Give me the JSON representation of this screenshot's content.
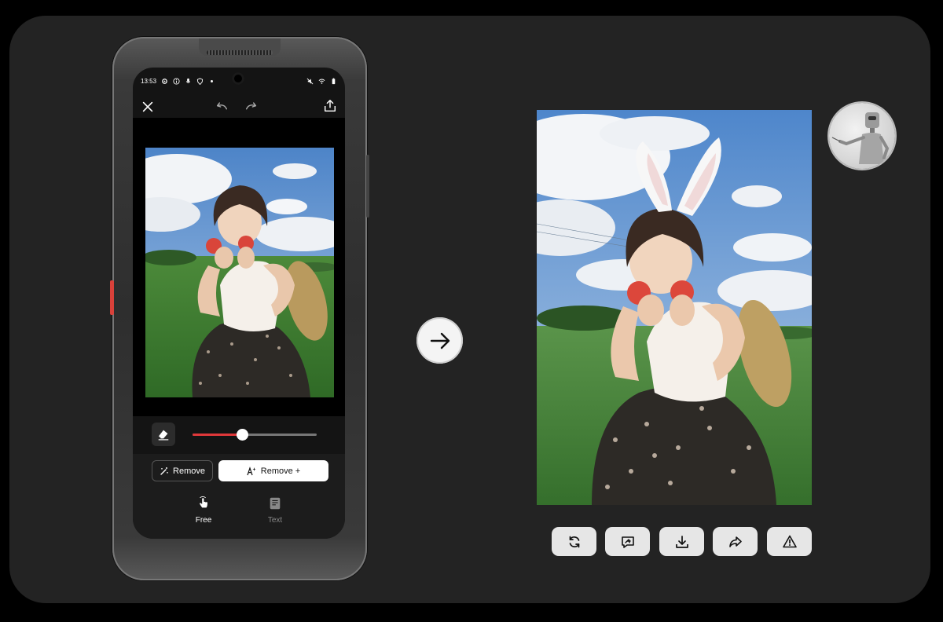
{
  "phone": {
    "status": {
      "time": "13:53",
      "left_icons": [
        "settings-icon",
        "info-icon",
        "mic-icon",
        "shield-icon",
        "dot-icon"
      ],
      "right_icons": [
        "mute-icon",
        "wifi-icon",
        "battery-icon"
      ]
    },
    "toolbar": {
      "close_icon": "close-icon",
      "undo_icon": "undo-icon",
      "redo_icon": "redo-icon",
      "share_icon": "upload-icon"
    },
    "brush_slider": {
      "value_fraction": 0.4
    },
    "buttons": {
      "remove_label": "Remove",
      "remove_plus_label": "Remove +"
    },
    "modes": {
      "free_label": "Free",
      "text_label": "Text",
      "active": "Free"
    }
  },
  "result": {
    "actions": [
      "refresh-icon",
      "chat-edit-icon",
      "download-icon",
      "share-icon",
      "report-icon"
    ]
  },
  "colors": {
    "background": "#000000",
    "stage": "#232323",
    "accent_red": "#e0383a",
    "button_light": "#e6e6e6"
  }
}
